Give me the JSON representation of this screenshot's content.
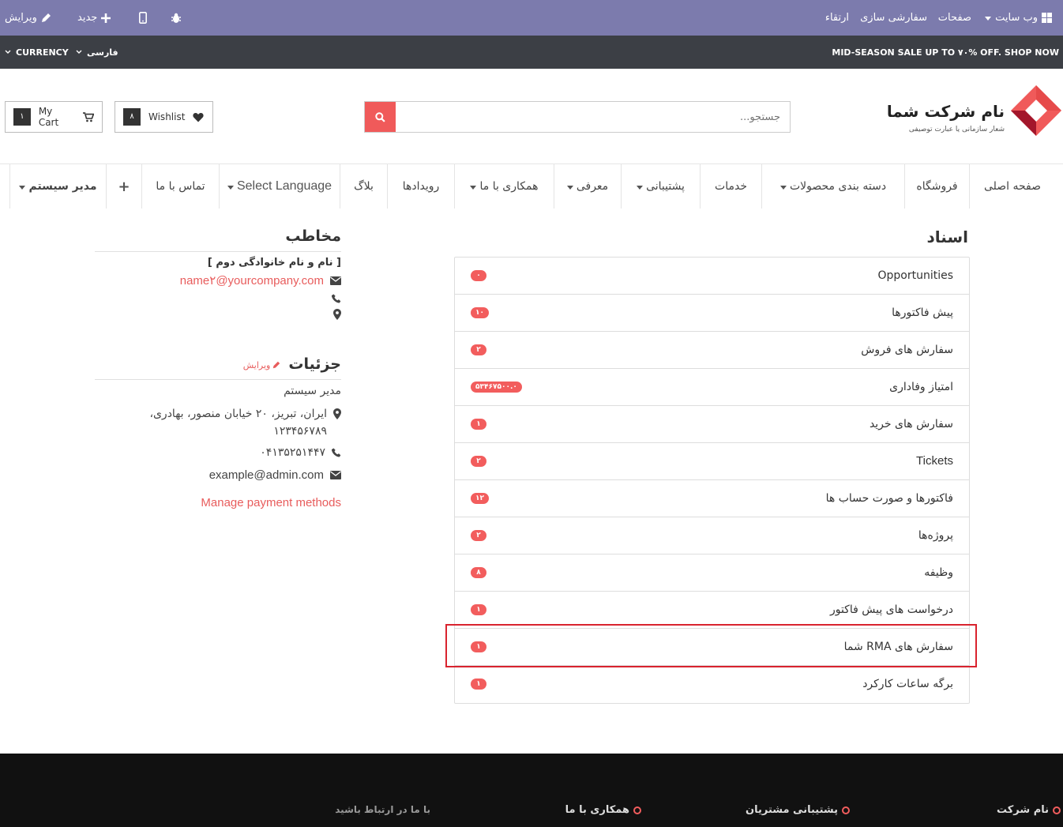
{
  "topbar": {
    "website": "وب سایت",
    "pages": "صفحات",
    "customize": "سفارشی سازی",
    "upgrade": "ارتقاء",
    "new": "جدید",
    "edit": "ویرایش",
    "bg_color": "#7c7bad"
  },
  "promo": {
    "text": "MID-SEASON SALE UP TO ۷۰% OFF. SHOP NOW",
    "currency": "CURRENCY",
    "language": "فارسی"
  },
  "header": {
    "company_name": "نام شرکت شما",
    "company_tagline": "شعار سازمانی یا عبارت توصیفی",
    "search_placeholder": "جستجو...",
    "wishlist_label": "Wishlist",
    "wishlist_count": "۸",
    "cart_label": "My Cart",
    "cart_count": "۱",
    "accent": "#f05a5a"
  },
  "menu": {
    "items": [
      "صفحه اصلی",
      "فروشگاه",
      "دسته بندی محصولات",
      "خدمات",
      "پشتیبانی",
      "معرفی",
      "همکاری با ما",
      "رویدادها",
      "بلاگ",
      "Select Language",
      "تماس با ما",
      "+",
      "مدیر سیستم"
    ]
  },
  "documents": {
    "title": "اسناد",
    "rows": [
      {
        "label": "Opportunities",
        "count": "۰"
      },
      {
        "label": "پیش فاکتورها",
        "count": "۱۰"
      },
      {
        "label": "سفارش های فروش",
        "count": "۲"
      },
      {
        "label": "امتیاز وفاداری",
        "count": "۵۳۴۶۷۵۰۰.۰"
      },
      {
        "label": "سفارش های خرید",
        "count": "۱"
      },
      {
        "label": "Tickets",
        "count": "۲"
      },
      {
        "label": "فاکتورها و صورت حساب ها",
        "count": "۱۲"
      },
      {
        "label": "پروژه‌ها",
        "count": "۲"
      },
      {
        "label": "وظیفه",
        "count": "۸"
      },
      {
        "label": "درخواست های پیش فاکتور",
        "count": "۱"
      },
      {
        "label": "سفارش های RMA شما",
        "count": "۱"
      },
      {
        "label": "برگه ساعات کارکرد",
        "count": "۱"
      }
    ]
  },
  "contact": {
    "title": "مخاطب",
    "name": "[ نام و نام خانوادگی دوم ]",
    "email": "name۲@yourcompany.com"
  },
  "details": {
    "title": "جزئیات",
    "edit": "ویرایش",
    "name": "مدیر سیستم",
    "address": "ایران، تبریز، ۲۰ خیابان منصور، بهادری، ۱۲۳۴۵۶۷۸۹",
    "phone": "۰۴۱۳۵۲۵۱۴۴۷",
    "email": "example@admin.com",
    "payment": "Manage payment methods"
  },
  "footer": {
    "col1": "نام شرکت",
    "col2": "پشتیبانی مشتریان",
    "col3": "همکاری با ما",
    "col4": "با ما در ارتباط باشید"
  }
}
